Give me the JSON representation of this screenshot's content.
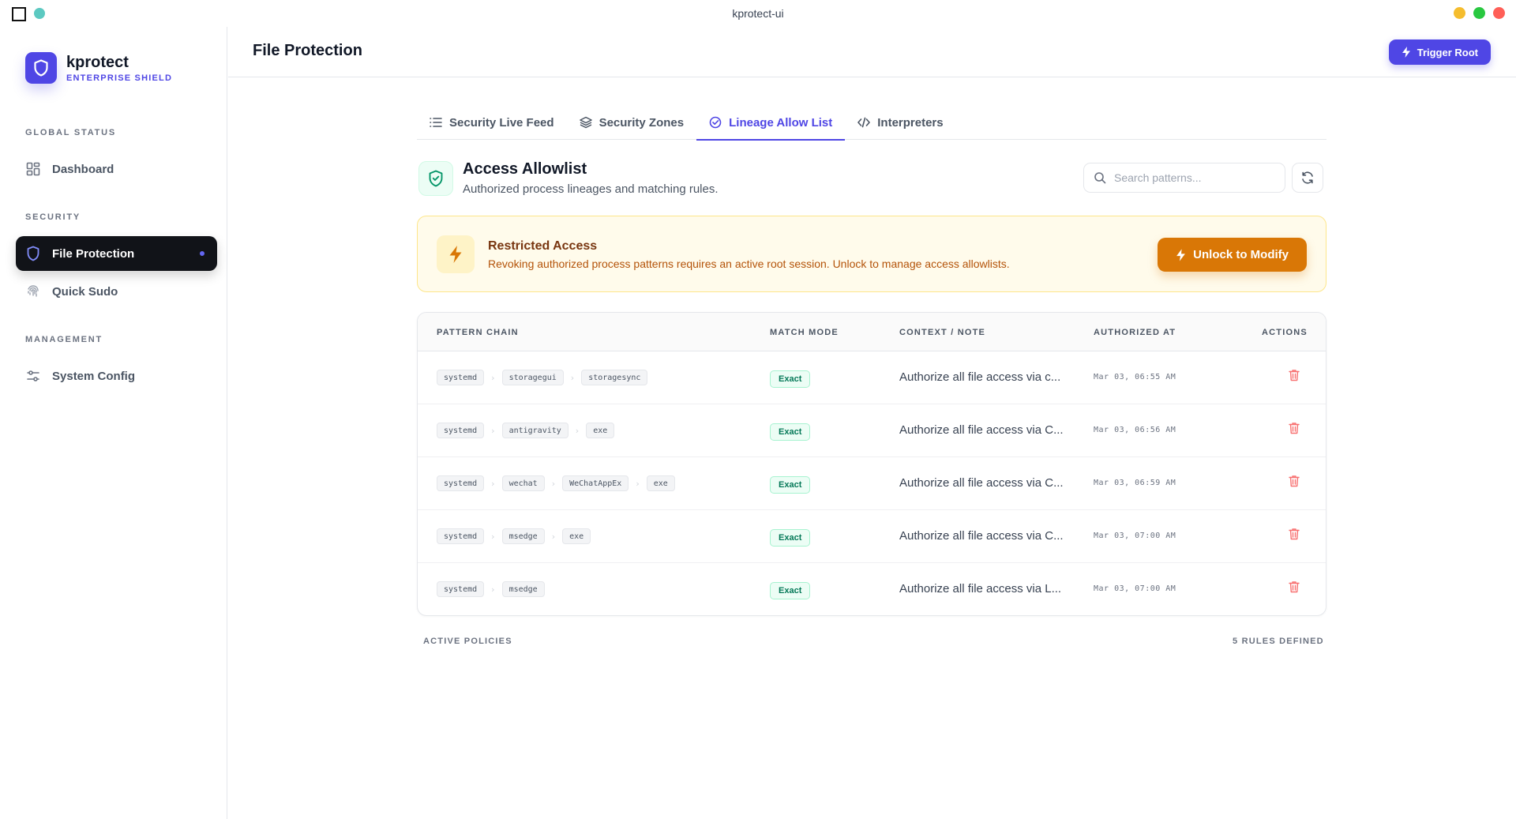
{
  "window": {
    "title": "kprotect-ui",
    "traffic_colors": [
      "#f5bd2e",
      "#29c840",
      "#ff5f57"
    ]
  },
  "brand": {
    "name": "kprotect",
    "subtitle": "ENTERPRISE SHIELD",
    "accent": "#4f46e5"
  },
  "sidebar": {
    "sections": [
      {
        "label": "GLOBAL STATUS",
        "items": [
          {
            "label": "Dashboard",
            "icon": "dashboard-grid-icon",
            "active": false
          }
        ]
      },
      {
        "label": "SECURITY",
        "items": [
          {
            "label": "File Protection",
            "icon": "shield-icon",
            "active": true
          },
          {
            "label": "Quick Sudo",
            "icon": "fingerprint-icon",
            "active": false
          }
        ]
      },
      {
        "label": "MANAGEMENT",
        "items": [
          {
            "label": "System Config",
            "icon": "sliders-icon",
            "active": false
          }
        ]
      }
    ]
  },
  "header": {
    "title": "File Protection",
    "trigger_label": "Trigger Root"
  },
  "tabs": [
    {
      "label": "Security Live Feed",
      "icon": "list-icon",
      "active": false
    },
    {
      "label": "Security Zones",
      "icon": "layers-icon",
      "active": false
    },
    {
      "label": "Lineage Allow List",
      "icon": "check-circle-icon",
      "active": true
    },
    {
      "label": "Interpreters",
      "icon": "code-icon",
      "active": false
    }
  ],
  "allowlist": {
    "title": "Access Allowlist",
    "subtitle": "Authorized process lineages and matching rules.",
    "search_placeholder": "Search patterns..."
  },
  "banner": {
    "title": "Restricted Access",
    "text": "Revoking authorized process patterns requires an active root session. Unlock to manage access allowlists.",
    "button": "Unlock to Modify"
  },
  "table": {
    "columns": [
      "PATTERN CHAIN",
      "MATCH MODE",
      "CONTEXT / NOTE",
      "AUTHORIZED AT",
      "ACTIONS"
    ],
    "rows": [
      {
        "chain": [
          "systemd",
          "storagegui",
          "storagesync"
        ],
        "mode": "Exact",
        "note": "Authorize all file access via c...",
        "time": "Mar 03, 06:55 AM"
      },
      {
        "chain": [
          "systemd",
          "antigravity",
          "exe"
        ],
        "mode": "Exact",
        "note": "Authorize all file access via C...",
        "time": "Mar 03, 06:56 AM"
      },
      {
        "chain": [
          "systemd",
          "wechat",
          "WeChatAppEx",
          "exe"
        ],
        "mode": "Exact",
        "note": "Authorize all file access via C...",
        "time": "Mar 03, 06:59 AM"
      },
      {
        "chain": [
          "systemd",
          "msedge",
          "exe"
        ],
        "mode": "Exact",
        "note": "Authorize all file access via C...",
        "time": "Mar 03, 07:00 AM"
      },
      {
        "chain": [
          "systemd",
          "msedge"
        ],
        "mode": "Exact",
        "note": "Authorize all file access via L...",
        "time": "Mar 03, 07:00 AM"
      }
    ]
  },
  "footer": {
    "left": "ACTIVE POLICIES",
    "right": "5 RULES DEFINED"
  }
}
